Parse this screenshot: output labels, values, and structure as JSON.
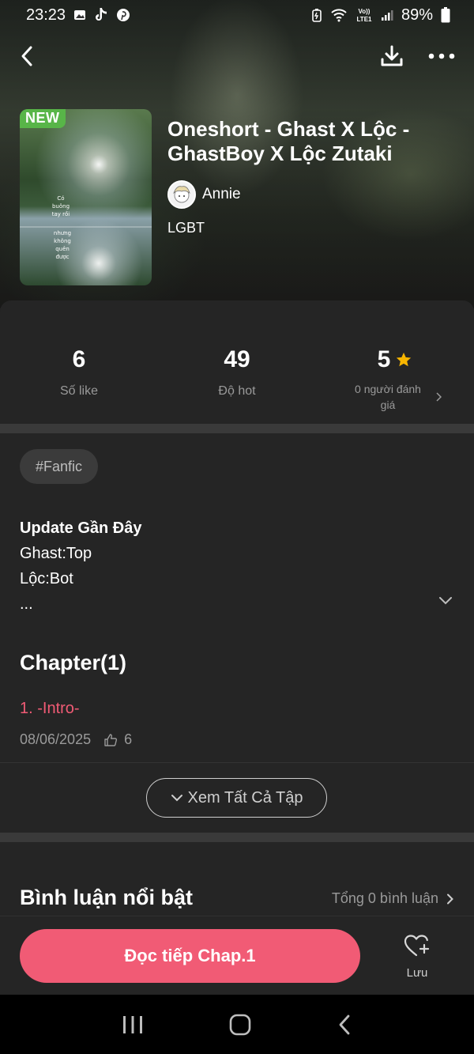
{
  "status_bar": {
    "time": "23:23",
    "battery": "89%",
    "left_icons": [
      "gallery-icon",
      "tiktok-icon",
      "pinterest-icon"
    ],
    "right_icons": [
      "battery-saver-icon",
      "wifi-icon",
      "volte-icon",
      "signal-icon",
      "battery-icon"
    ]
  },
  "nav": {
    "back_icon": "chevron-left-icon",
    "download_icon": "download-icon",
    "more_icon": "more-horizontal-icon"
  },
  "story": {
    "badge": "NEW",
    "cover_caption_1": "Có buông tay rồi",
    "cover_caption_2": "nhưng không quên được",
    "title": "Oneshort - Ghast X Lộc - GhastBoy X Lộc Zutaki",
    "author": "Annie",
    "genre": "LGBT"
  },
  "stats": {
    "likes_value": "6",
    "likes_label": "Số like",
    "hot_value": "49",
    "hot_label": "Độ hot",
    "rating_value": "5",
    "rating_label": "0 người đánh giá"
  },
  "tag": "#Fanfic",
  "description": {
    "heading": "Update Gần Đây",
    "line1": "Ghast:Top",
    "line2": "Lộc:Bot",
    "line3": "..."
  },
  "chapters": {
    "heading": "Chapter(1)",
    "items": [
      {
        "title": "1. -Intro-",
        "date": "08/06/2025",
        "likes": "6"
      }
    ],
    "see_all": "Xem Tất Cả Tập"
  },
  "comments": {
    "heading": "Bình luận nổi bật",
    "total": "Tổng 0 bình luận"
  },
  "actions": {
    "read_label": "Đọc tiếp Chap.1",
    "save_label": "Lưu"
  },
  "colors": {
    "accent": "#f15b75",
    "new_badge": "#58b548",
    "background": "#252525",
    "star": "#f7b500"
  }
}
